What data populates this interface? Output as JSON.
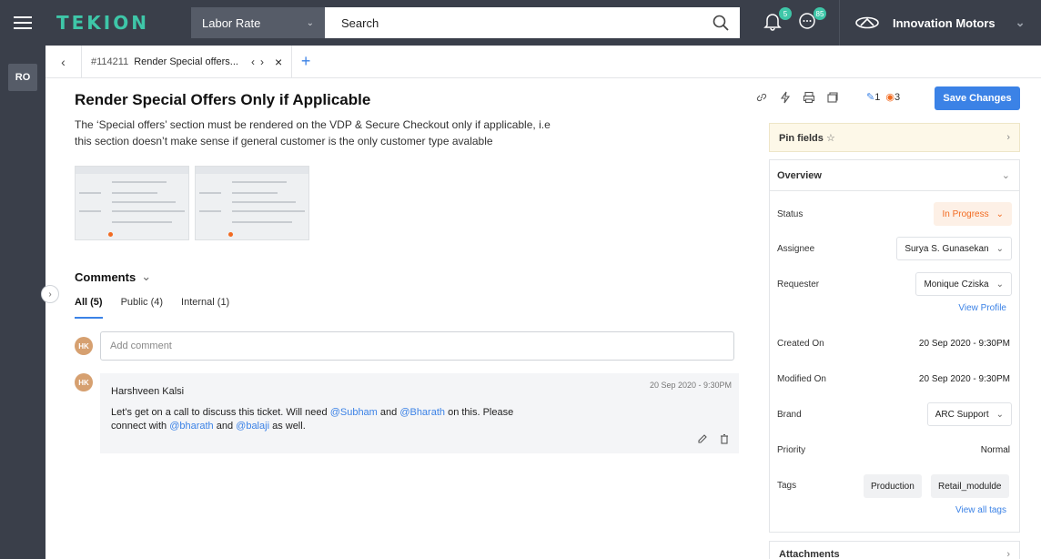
{
  "topbar": {
    "logo": "TEKION",
    "select_value": "Labor Rate",
    "search_text": "Search",
    "notifications_badge": "5",
    "chat_badge": "85",
    "dealer_name": "Innovation Motors"
  },
  "leftrail": {
    "ro_label": "RO"
  },
  "tabbar": {
    "tab_id": "#114211",
    "tab_title": "Render Special offers...",
    "close_glyph": "×",
    "add_glyph": "+"
  },
  "ticket": {
    "title": "Render Special Offers Only if Applicable",
    "description": "The ‘Special offers’ section must be rendered on the VDP & Secure Checkout only if applicable, i.e this section doesn’t make sense if general customer is the only customer type avalable"
  },
  "comments": {
    "heading": "Comments",
    "tabs": [
      {
        "label": "All (5)"
      },
      {
        "label": "Public (4)"
      },
      {
        "label": "Internal (1)"
      }
    ],
    "add_placeholder": "Add comment",
    "current_user_initials": "HK",
    "items": [
      {
        "initials": "HK",
        "author": "Harshveen Kalsi",
        "time": "20 Sep 2020 - 9:30PM",
        "parts": {
          "t1": "Let’s get on a call to discuss this ticket. Will need ",
          "m1": "@Subham",
          "t2": " and ",
          "m2": "@Bharath",
          "t3": " on this. Please connect with ",
          "m3": "@bharath",
          "t4": " and ",
          "m4": "@balaji",
          "t5": " as well."
        }
      }
    ]
  },
  "header_actions": {
    "watch_edits": "1",
    "watch_views": "3",
    "save_label": "Save Changes"
  },
  "pin_fields": {
    "label": "Pin fields"
  },
  "overview": {
    "heading": "Overview",
    "status_label": "Status",
    "status_value": "In Progress",
    "assignee_label": "Assignee",
    "assignee_value": "Surya S. Gunasekan",
    "requester_label": "Requester",
    "requester_value": "Monique Cziska",
    "view_profile": "View Profile",
    "created_label": "Created On",
    "created_value": "20 Sep 2020 - 9:30PM",
    "modified_label": "Modified On",
    "modified_value": "20 Sep 2020 - 9:30PM",
    "brand_label": "Brand",
    "brand_value": "ARC Support",
    "priority_label": "Priority",
    "priority_value": "Normal",
    "tags_label": "Tags",
    "tags": [
      "Production",
      "Retail_modulde"
    ],
    "view_all_tags": "View all tags"
  },
  "attachments": {
    "label": "Attachments"
  },
  "colors": {
    "accent": "#3b82e6",
    "brand": "#3ec6a8",
    "status": "#f26b21"
  }
}
